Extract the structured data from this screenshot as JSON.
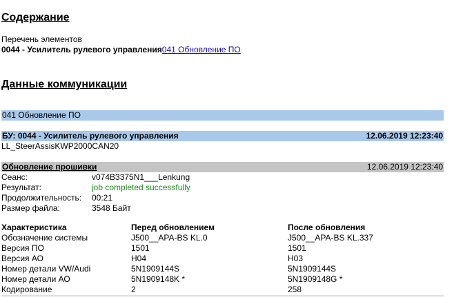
{
  "contents": {
    "title": "Содержание",
    "list_label": "Перечень элементов",
    "ecu_entry": "0044 - Усилитель рулевого управления",
    "ecu_link": "041 Обновление ПО"
  },
  "communication": {
    "title": "Данные коммуникации",
    "section_title": "041 Обновление ПО",
    "ecu_header": "БУ: 0044 - Усилитель рулевого управления",
    "ecu_timestamp": "12.06.2019 12:23:40",
    "ecu_variant": "LL_SteerAssisKWP2000CAN20"
  },
  "flash": {
    "title": "Обновление прошивки",
    "timestamp": "12.06.2019 12:23:40",
    "session_label": "Сеанс:",
    "session_value": "v074B3375N1___Lenkung",
    "result_label": "Результат:",
    "result_value": "job completed successfully",
    "result_color": "#1c8a1c",
    "duration_label": "Продолжительность:",
    "duration_value": "00:21",
    "filesize_label": "Размер файла:",
    "filesize_value": "3548 Байт"
  },
  "table": {
    "headers": [
      "Характеристика",
      "Перед обновлением",
      "После обновления"
    ],
    "rows": [
      [
        "Обозначение системы",
        "J500__APA-BS KL.0",
        "J500__APA-BS KL.337"
      ],
      [
        "Версия ПО",
        "1501",
        "1501"
      ],
      [
        "Версия АО",
        "H04",
        "H03"
      ],
      [
        "Номер детали VW/Audi",
        "5N1909144S",
        "5N1909144S"
      ],
      [
        "Номер детали АО",
        "5N1909148K *",
        "5N1909148G *"
      ],
      [
        "Кодирование",
        "2",
        "258"
      ]
    ]
  },
  "colors": {
    "section_bar": "#a9c9ea",
    "flash_bar": "#c4c4c4",
    "link": "#1a0dab"
  }
}
